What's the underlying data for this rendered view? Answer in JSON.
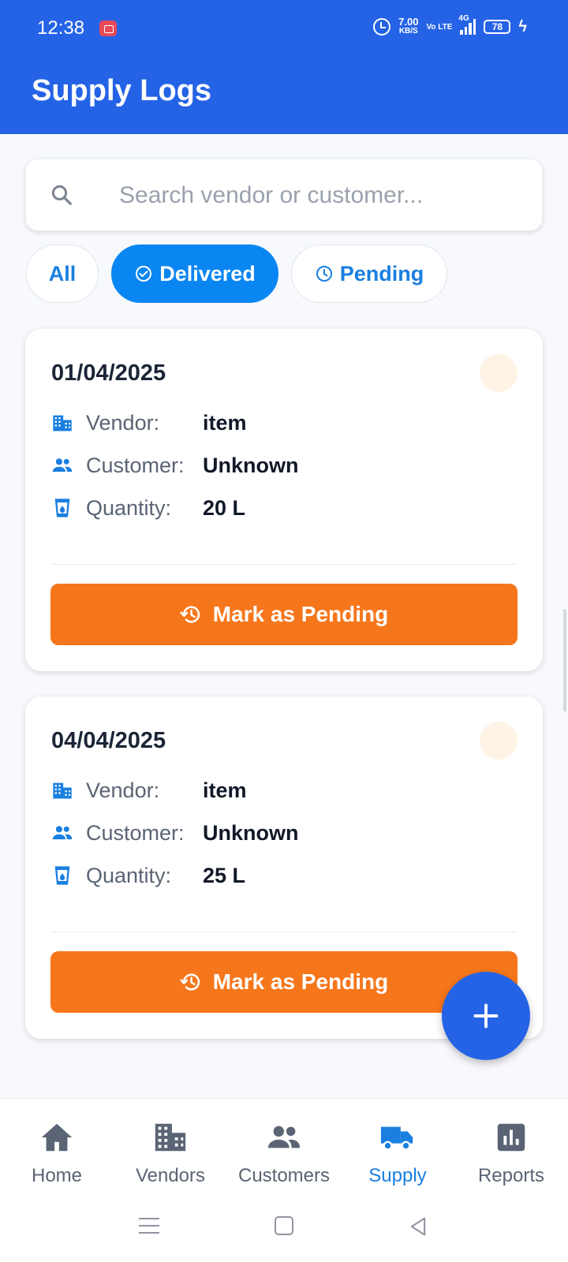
{
  "status_bar": {
    "time": "12:38",
    "net_speed": "7.00",
    "net_speed_unit": "KB/S",
    "volte": "Vo LTE",
    "network": "4G",
    "battery": "78"
  },
  "header": {
    "title": "Supply Logs"
  },
  "search": {
    "placeholder": "Search vendor or customer...",
    "value": ""
  },
  "filters": [
    {
      "label": "All",
      "active": false
    },
    {
      "label": "Delivered",
      "active": true,
      "icon": "check-circle-icon"
    },
    {
      "label": "Pending",
      "active": false,
      "icon": "clock-icon"
    }
  ],
  "labels": {
    "vendor": "Vendor:",
    "customer": "Customer:",
    "quantity": "Quantity:"
  },
  "logs": [
    {
      "date": "01/04/2025",
      "vendor": "item",
      "customer": "Unknown",
      "quantity": "20 L",
      "action": "Mark as Pending"
    },
    {
      "date": "04/04/2025",
      "vendor": "item",
      "customer": "Unknown",
      "quantity": "25 L",
      "action": "Mark as Pending"
    }
  ],
  "bottom_nav": [
    {
      "label": "Home",
      "icon": "home-icon",
      "active": false
    },
    {
      "label": "Vendors",
      "icon": "building-icon",
      "active": false
    },
    {
      "label": "Customers",
      "icon": "people-icon",
      "active": false
    },
    {
      "label": "Supply",
      "icon": "truck-icon",
      "active": true
    },
    {
      "label": "Reports",
      "icon": "bar-chart-icon",
      "active": false
    }
  ],
  "colors": {
    "primary": "#2563e6",
    "chip_active": "#0a86f3",
    "accent_orange": "#f6761b",
    "nav_active": "#1a7fe0"
  }
}
